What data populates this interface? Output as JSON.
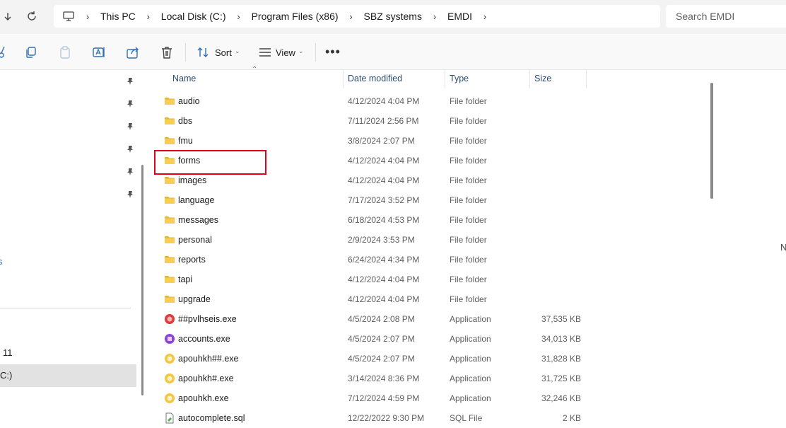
{
  "breadcrumbs": [
    "This PC",
    "Local Disk (C:)",
    "Program Files (x86)",
    "SBZ systems",
    "EMDI"
  ],
  "search": {
    "placeholder": "Search EMDI"
  },
  "toolbar": {
    "sort_label": "Sort",
    "view_label": "View"
  },
  "left_fragments": {
    "a": "11",
    "b": "C:)",
    "c": "s",
    "right": "N"
  },
  "columns": {
    "name": "Name",
    "date": "Date modified",
    "type": "Type",
    "size": "Size"
  },
  "files": [
    {
      "name": "audio",
      "date": "4/12/2024 4:04 PM",
      "type": "File folder",
      "size": "",
      "icon": "folder-icon"
    },
    {
      "name": "dbs",
      "date": "7/11/2024 2:56 PM",
      "type": "File folder",
      "size": "",
      "icon": "folder-icon"
    },
    {
      "name": "fmu",
      "date": "3/8/2024 2:07 PM",
      "type": "File folder",
      "size": "",
      "icon": "folder-icon"
    },
    {
      "name": "forms",
      "date": "4/12/2024 4:04 PM",
      "type": "File folder",
      "size": "",
      "icon": "folder-icon"
    },
    {
      "name": "images",
      "date": "4/12/2024 4:04 PM",
      "type": "File folder",
      "size": "",
      "icon": "folder-icon"
    },
    {
      "name": "language",
      "date": "7/17/2024 3:52 PM",
      "type": "File folder",
      "size": "",
      "icon": "folder-icon"
    },
    {
      "name": "messages",
      "date": "6/18/2024 4:53 PM",
      "type": "File folder",
      "size": "",
      "icon": "folder-icon"
    },
    {
      "name": "personal",
      "date": "2/9/2024 3:53 PM",
      "type": "File folder",
      "size": "",
      "icon": "folder-icon"
    },
    {
      "name": "reports",
      "date": "6/24/2024 4:34 PM",
      "type": "File folder",
      "size": "",
      "icon": "folder-icon"
    },
    {
      "name": "tapi",
      "date": "4/12/2024 4:04 PM",
      "type": "File folder",
      "size": "",
      "icon": "folder-icon"
    },
    {
      "name": "upgrade",
      "date": "4/12/2024 4:04 PM",
      "type": "File folder",
      "size": "",
      "icon": "folder-icon"
    },
    {
      "name": "##pvlhseis.exe",
      "date": "4/5/2024 2:08 PM",
      "type": "Application",
      "size": "37,535 KB",
      "icon": "app-red-icon"
    },
    {
      "name": "accounts.exe",
      "date": "4/5/2024 2:07 PM",
      "type": "Application",
      "size": "34,013 KB",
      "icon": "app-purple-icon"
    },
    {
      "name": "apouhkh##.exe",
      "date": "4/5/2024 2:07 PM",
      "type": "Application",
      "size": "31,828 KB",
      "icon": "app-yellow-icon"
    },
    {
      "name": "apouhkh#.exe",
      "date": "3/14/2024 8:36 PM",
      "type": "Application",
      "size": "31,725 KB",
      "icon": "app-yellow-icon"
    },
    {
      "name": "apouhkh.exe",
      "date": "7/12/2024 4:59 PM",
      "type": "Application",
      "size": "32,246 KB",
      "icon": "app-yellow-icon"
    },
    {
      "name": "autocomplete.sql",
      "date": "12/22/2022 9:30 PM",
      "type": "SQL File",
      "size": "2 KB",
      "icon": "sql-file-icon"
    }
  ],
  "highlighted_item": "forms",
  "colors": {
    "highlight_border": "#e0001b",
    "folder": "#f5c342"
  }
}
